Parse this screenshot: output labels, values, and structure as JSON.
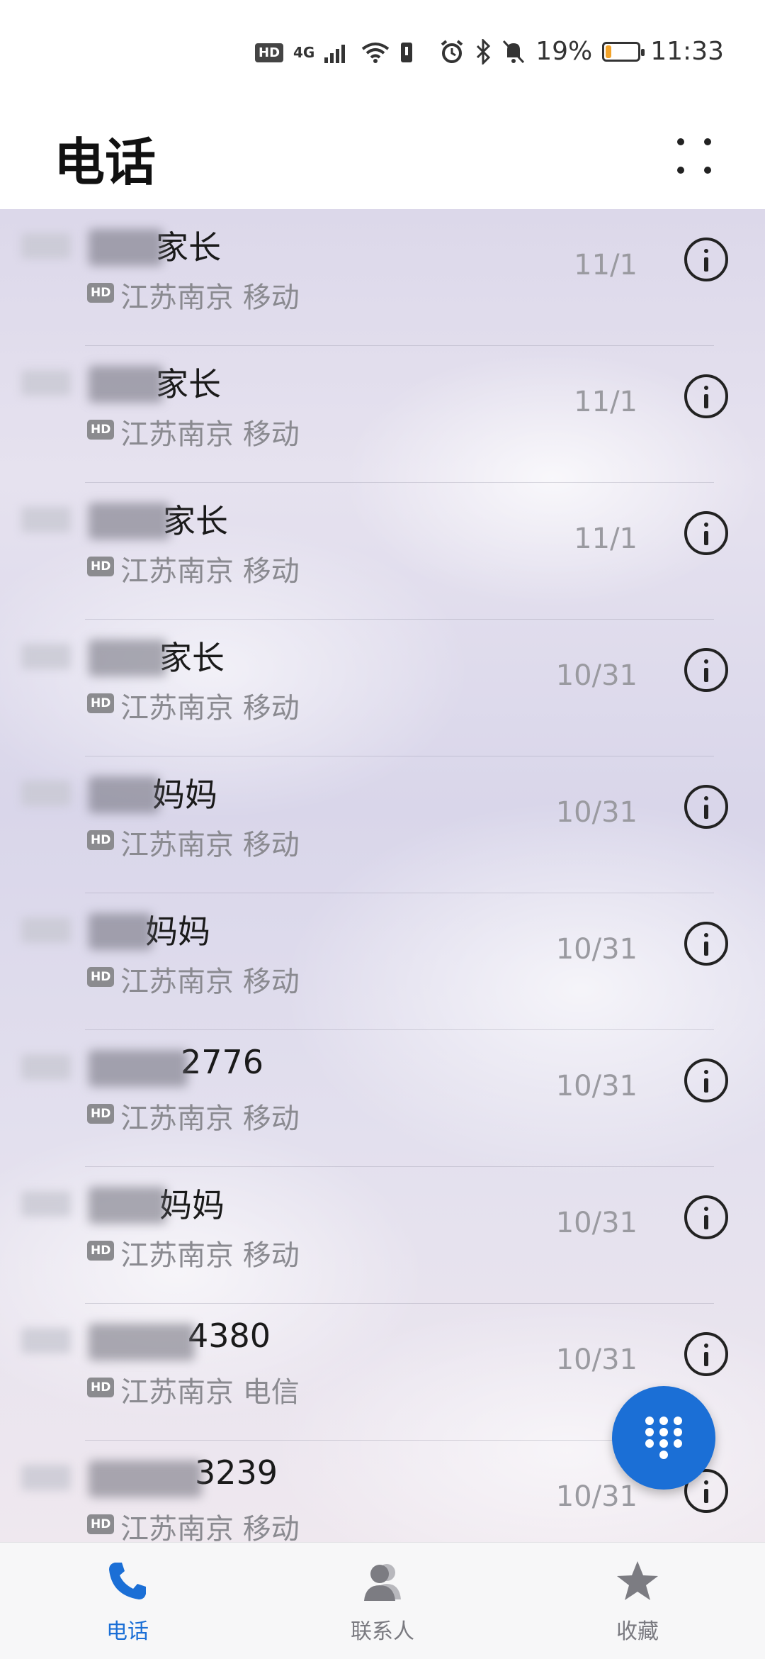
{
  "status_bar": {
    "hd": "HD",
    "network": "4G",
    "battery_percent": "19%",
    "battery_level": 0.19,
    "time": "11:33",
    "battery_color": "#f2a32a"
  },
  "header": {
    "title": "电话"
  },
  "calls": [
    {
      "name_visible": "家长",
      "location": "江苏南京 移动",
      "date": "11/1",
      "hd": "HD"
    },
    {
      "name_visible": "家长",
      "location": "江苏南京 移动",
      "date": "11/1",
      "hd": "HD"
    },
    {
      "name_visible": "家长",
      "location": "江苏南京 移动",
      "date": "11/1",
      "hd": "HD"
    },
    {
      "name_visible": "家长",
      "location": "江苏南京 移动",
      "date": "10/31",
      "hd": "HD"
    },
    {
      "name_visible": "妈妈",
      "location": "江苏南京 移动",
      "date": "10/31",
      "hd": "HD"
    },
    {
      "name_visible": "妈妈",
      "location": "江苏南京 移动",
      "date": "10/31",
      "hd": "HD"
    },
    {
      "name_visible": "2776",
      "location": "江苏南京 移动",
      "date": "10/31",
      "hd": "HD"
    },
    {
      "name_visible": "妈妈",
      "location": "江苏南京 移动",
      "date": "10/31",
      "hd": "HD"
    },
    {
      "name_visible": "4380",
      "location": "江苏南京 电信",
      "date": "10/31",
      "hd": "HD"
    },
    {
      "name_visible": "3239",
      "location": "江苏南京 移动",
      "date": "10/31",
      "hd": "HD"
    }
  ],
  "bottom_nav": {
    "items": [
      {
        "label": "电话",
        "icon": "phone-icon",
        "active": true
      },
      {
        "label": "联系人",
        "icon": "contacts-icon",
        "active": false
      },
      {
        "label": "收藏",
        "icon": "star-icon",
        "active": false
      }
    ]
  },
  "colors": {
    "accent": "#1b6fd6"
  }
}
